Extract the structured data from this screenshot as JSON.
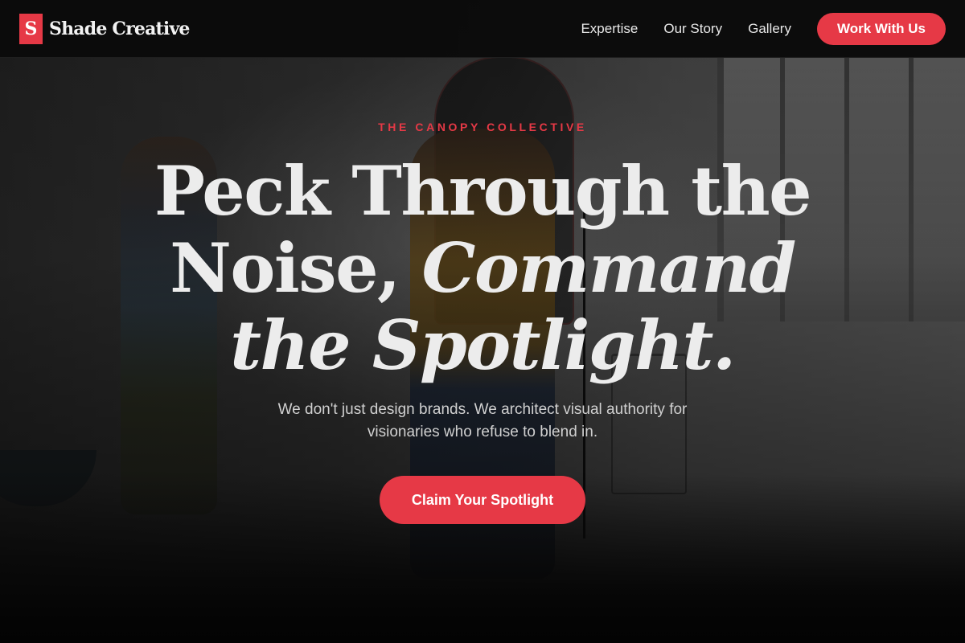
{
  "brand": {
    "logo_letter": "S",
    "name": "Shade Creative",
    "accent_color": "#e63946"
  },
  "nav": {
    "links": [
      "Expertise",
      "Our Story",
      "Gallery"
    ],
    "cta_label": "Work With Us"
  },
  "hero": {
    "eyebrow": "THE CANOPY COLLECTIVE",
    "headline_plain": "Peck Through the Noise,",
    "headline_italic": "Command the Spotlight.",
    "subtext": "We don't just design brands. We architect visual authority for visionaries who refuse to blend in.",
    "cta_label": "Claim Your Spotlight"
  }
}
